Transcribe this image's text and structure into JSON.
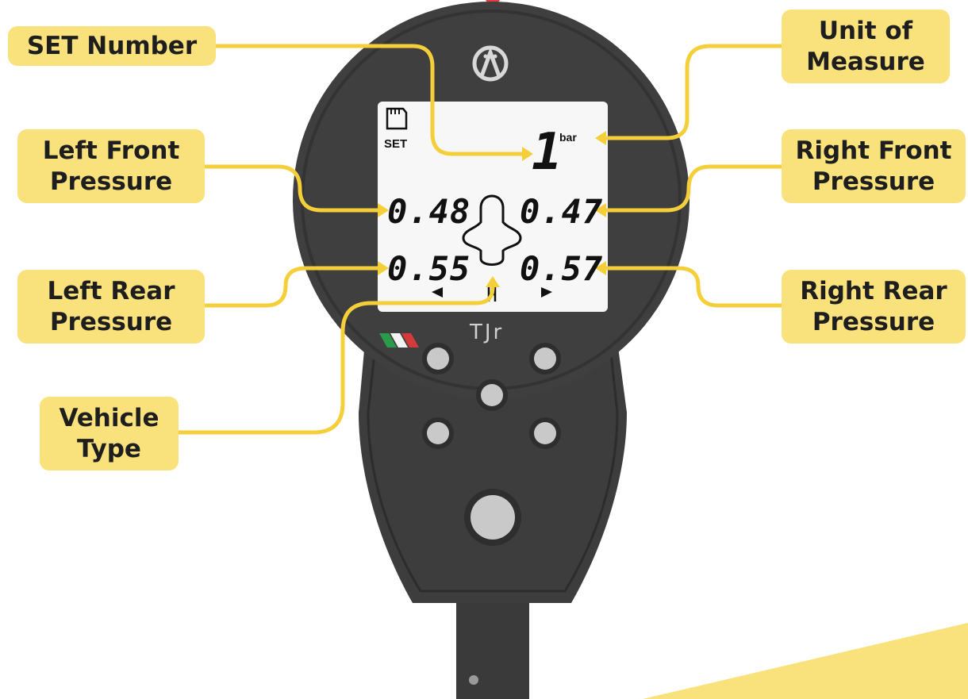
{
  "labels": {
    "set_number": "SET Number",
    "unit_of_measure": "Unit of\nMeasure",
    "left_front": "Left Front\nPressure",
    "right_front": "Right Front\nPressure",
    "left_rear": "Left Rear\nPressure",
    "right_rear": "Right Rear\nPressure",
    "vehicle_type": "Vehicle\nType"
  },
  "display": {
    "set_caption": "SET",
    "set_value": "1",
    "unit": "bar",
    "left_front_value": "0.48",
    "right_front_value": "0.47",
    "left_rear_value": "0.55",
    "right_rear_value": "0.57"
  },
  "device": {
    "model_mark": "TJr"
  },
  "colors": {
    "label_fill": "#f9e27c",
    "connector": "#f5cf3a",
    "device_body": "#3b3b3b",
    "lcd_background": "#f7f7f7",
    "button": "#c9c9c9"
  }
}
